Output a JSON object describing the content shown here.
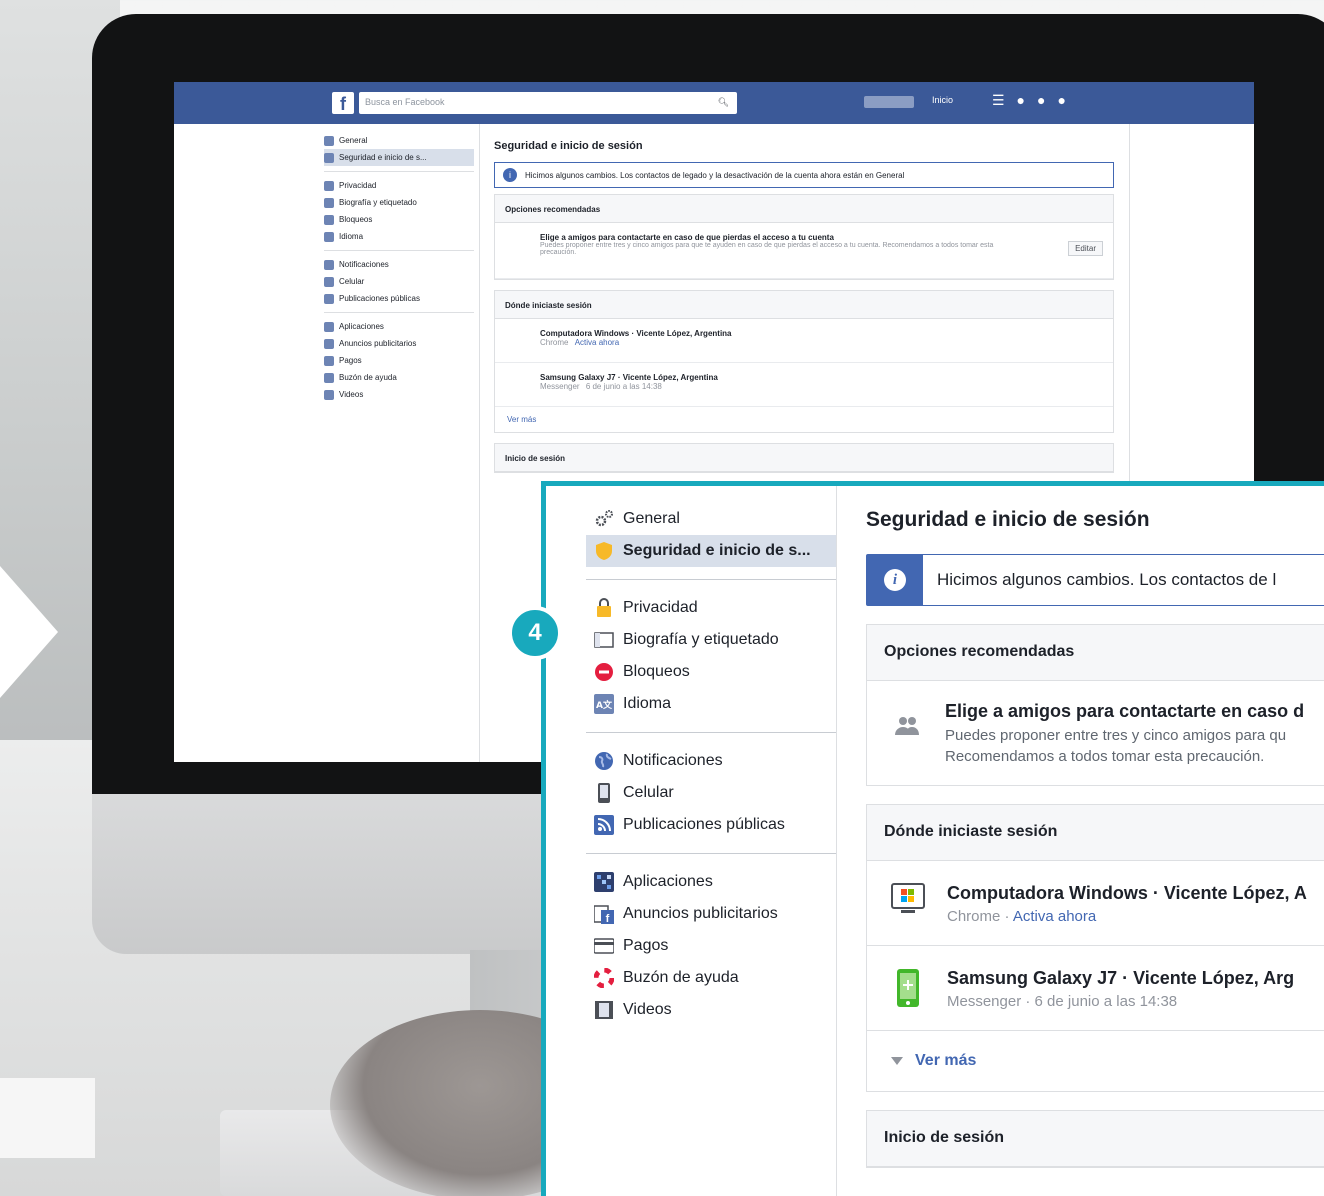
{
  "colors": {
    "accent": "#18a9bd",
    "facebook_blue": "#3b5998",
    "link_blue": "#4267b2",
    "selected_row": "#d8dfea"
  },
  "badge": {
    "number": "4"
  },
  "monitor_screen": {
    "search_placeholder": "Busca en Facebook",
    "nav_home": "Inicio",
    "page_title": "Seguridad e inicio de sesión",
    "info_text": "Hicimos algunos cambios. Los contactos de legado y la desactivación de la cuenta ahora están en General",
    "sidebar": [
      {
        "label": "General",
        "icon": "gear-icon"
      },
      {
        "label": "Seguridad e inicio de s...",
        "icon": "shield-icon",
        "selected": true
      },
      {
        "label": "Privacidad",
        "icon": "lock-icon",
        "group_start": true
      },
      {
        "label": "Biografía y etiquetado",
        "icon": "timeline-icon"
      },
      {
        "label": "Bloqueos",
        "icon": "block-icon"
      },
      {
        "label": "Idioma",
        "icon": "language-icon"
      },
      {
        "label": "Notificaciones",
        "icon": "globe-icon",
        "group_start": true
      },
      {
        "label": "Celular",
        "icon": "phone-icon"
      },
      {
        "label": "Publicaciones públicas",
        "icon": "rss-icon"
      },
      {
        "label": "Aplicaciones",
        "icon": "apps-icon",
        "group_start": true
      },
      {
        "label": "Anuncios publicitarios",
        "icon": "ads-icon"
      },
      {
        "label": "Pagos",
        "icon": "card-icon"
      },
      {
        "label": "Buzón de ayuda",
        "icon": "lifebuoy-icon"
      },
      {
        "label": "Videos",
        "icon": "film-icon"
      }
    ],
    "recommended_header": "Opciones recomendadas",
    "recommended_title": "Elige a amigos para contactarte en caso de que pierdas el acceso a tu cuenta",
    "recommended_desc": "Puedes proponer entre tres y cinco amigos para que te ayuden en caso de que pierdas el acceso a tu cuenta. Recomendamos a todos tomar esta precaución.",
    "edit_button": "Editar",
    "where_header": "Dónde iniciaste sesión",
    "devices": [
      {
        "title": "Computadora Windows · Vicente López, Argentina",
        "app": "Chrome",
        "status": "Activa ahora"
      },
      {
        "title": "Samsung Galaxy J7 · Vicente López, Argentina",
        "app": "Messenger",
        "status": "6 de junio a las 14:38"
      }
    ],
    "see_more": "Ver más",
    "login_header": "Inicio de sesión"
  },
  "zoom_panel": {
    "page_title": "Seguridad e inicio de sesión",
    "info_text": "Hicimos algunos cambios. Los contactos de l",
    "sidebar_groups": [
      [
        {
          "label": "General",
          "icon": "gear-icon"
        },
        {
          "label": "Seguridad e inicio de s...",
          "icon": "shield-icon",
          "selected": true
        }
      ],
      [
        {
          "label": "Privacidad",
          "icon": "lock-icon"
        },
        {
          "label": "Biografía y etiquetado",
          "icon": "timeline-icon"
        },
        {
          "label": "Bloqueos",
          "icon": "block-icon"
        },
        {
          "label": "Idioma",
          "icon": "language-icon"
        }
      ],
      [
        {
          "label": "Notificaciones",
          "icon": "globe-icon"
        },
        {
          "label": "Celular",
          "icon": "phone-icon"
        },
        {
          "label": "Publicaciones públicas",
          "icon": "rss-icon"
        }
      ],
      [
        {
          "label": "Aplicaciones",
          "icon": "apps-icon"
        },
        {
          "label": "Anuncios publicitarios",
          "icon": "ads-icon"
        },
        {
          "label": "Pagos",
          "icon": "card-icon"
        },
        {
          "label": "Buzón de ayuda",
          "icon": "lifebuoy-icon"
        },
        {
          "label": "Videos",
          "icon": "film-icon"
        }
      ]
    ],
    "recommended_header": "Opciones recomendadas",
    "recommended_title": "Elige a amigos para contactarte en caso d",
    "recommended_line1": "Puedes proponer entre tres y cinco amigos para qu",
    "recommended_line2": "Recomendamos a todos tomar esta precaución.",
    "where_header": "Dónde iniciaste sesión",
    "device1_title": "Computadora Windows · Vicente López, A",
    "device1_app": "Chrome · ",
    "device1_status": "Activa ahora",
    "device2_title": "Samsung Galaxy J7 · Vicente López, Arg",
    "device2_meta": "Messenger · 6 de junio a las 14:38",
    "see_more": "Ver más",
    "login_header": "Inicio de sesión"
  }
}
